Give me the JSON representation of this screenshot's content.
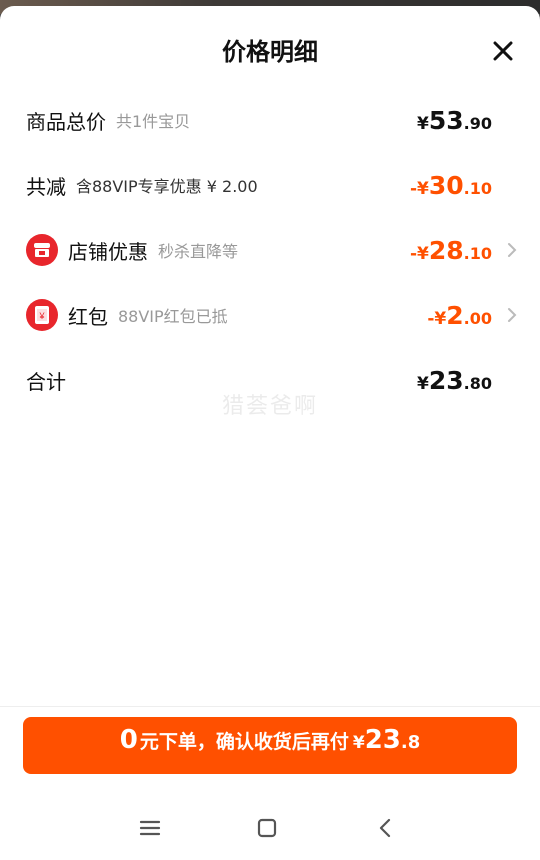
{
  "header": {
    "title": "价格明细"
  },
  "rows": {
    "total_price": {
      "label": "商品总价",
      "sub": "共1件宝贝",
      "yen": "¥",
      "int": "53",
      "dec": ".90"
    },
    "total_reduction": {
      "label": "共减",
      "sub": "含88VIP专享优惠 ¥ 2.00",
      "yen": "-¥",
      "int": "30",
      "dec": ".10"
    },
    "store_discount": {
      "label": "店铺优惠",
      "sub": "秒杀直降等",
      "icon": "shop-icon",
      "yen": "-¥",
      "int": "28",
      "dec": ".10"
    },
    "red_packet": {
      "label": "红包",
      "sub": "88VIP红包已抵",
      "icon": "red-packet-icon",
      "icon_glyph": "¥",
      "yen": "-¥",
      "int": "2",
      "dec": ".00"
    },
    "sum": {
      "label": "合计",
      "yen": "¥",
      "int": "23",
      "dec": ".80"
    }
  },
  "watermark": "猎荟爸啊",
  "cta": {
    "big": "0",
    "text": "元下单，确认收货后再付",
    "yen": "¥",
    "int": "23",
    "dec": ".8"
  },
  "colors": {
    "accent": "#ff5000",
    "badge": "#e8262c"
  },
  "navbar": {
    "icons": [
      "menu-icon",
      "home-icon",
      "back-icon"
    ]
  }
}
